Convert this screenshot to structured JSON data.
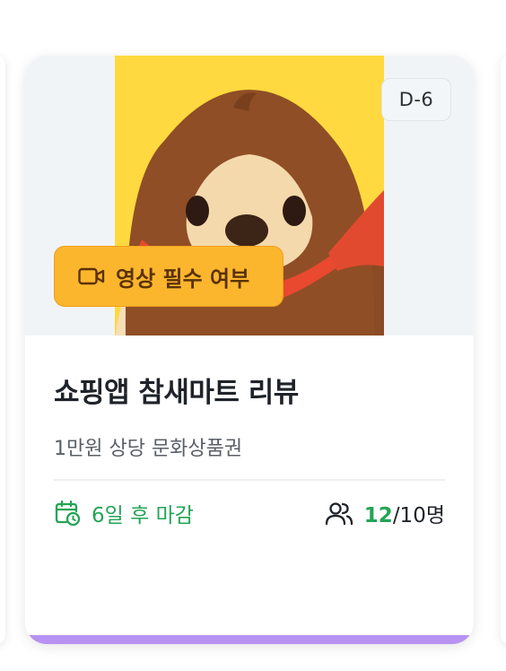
{
  "card": {
    "dday_badge": "D-6",
    "thumbnail_alt": "sparrow mascot with red scarf",
    "video_badge": {
      "icon": "video-camera-icon",
      "label": "영상 필수 여부"
    },
    "title": "쇼핑앱 참새마트 리뷰",
    "reward": "1만원 상당 문화상품권",
    "deadline": {
      "icon": "calendar-clock-icon",
      "label": "6일 후 마감"
    },
    "participants": {
      "icon": "users-icon",
      "current": "12",
      "total": "/10명"
    }
  },
  "colors": {
    "accent_green": "#23a455",
    "badge_orange": "#fbb62e",
    "thumbnail_yellow": "#ffd93f",
    "bottom_bar_purple": "#b892f2"
  }
}
